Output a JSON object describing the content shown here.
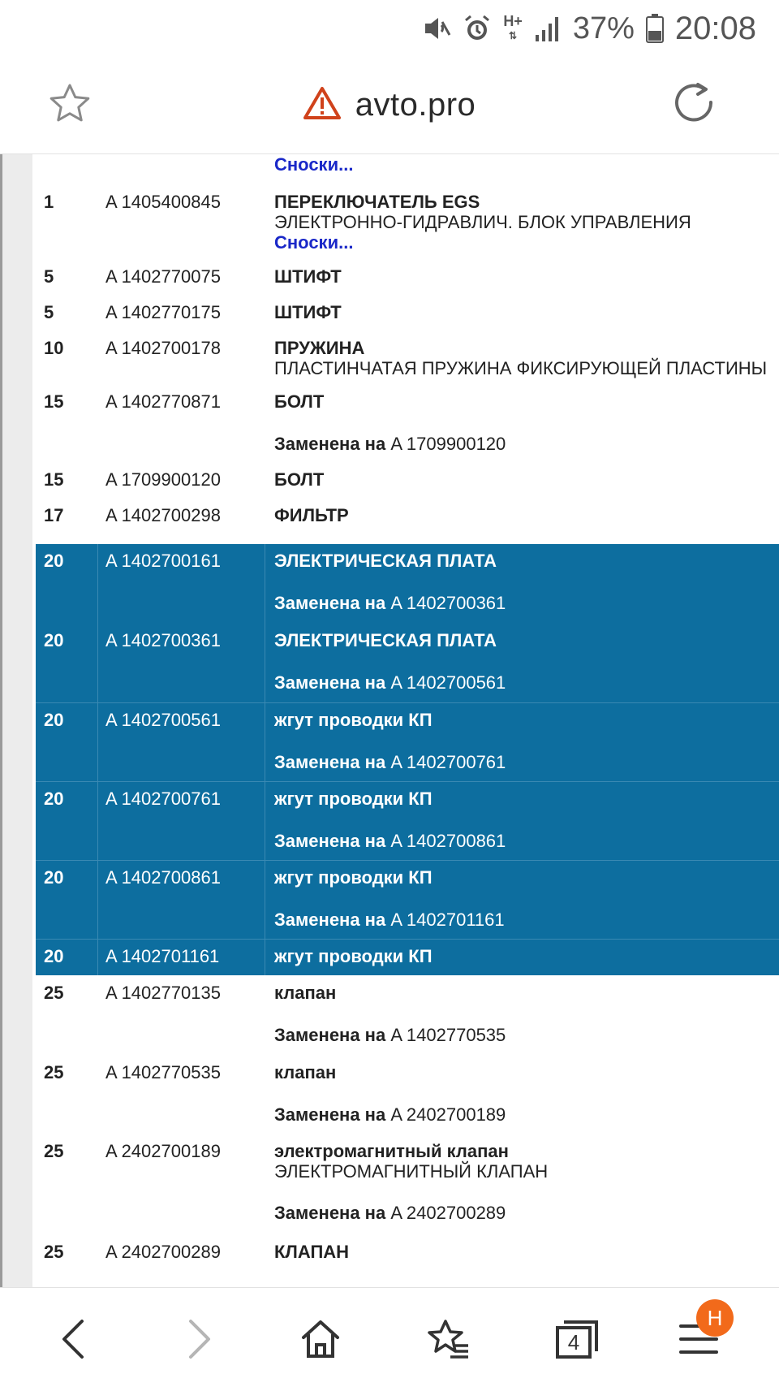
{
  "status_bar": {
    "battery": "37%",
    "time": "20:08",
    "network_label": "H+"
  },
  "address_bar": {
    "url": "avto.pro"
  },
  "rows": [
    {
      "num": "",
      "code": "",
      "name": "",
      "sub": "",
      "footnote": "Сноски...",
      "rep_label": "",
      "rep_code": ""
    },
    {
      "num": "1",
      "code": "A 1405400845",
      "name": "ПЕРЕКЛЮЧАТЕЛЬ EGS",
      "sub": "ЭЛЕКТРОННО-ГИДРАВЛИЧ. БЛОК УПРАВЛЕНИЯ",
      "footnote": "Сноски...",
      "rep_label": "",
      "rep_code": ""
    },
    {
      "num": "5",
      "code": "A 1402770075",
      "name": "ШТИФТ"
    },
    {
      "num": "5",
      "code": "A 1402770175",
      "name": "ШТИФТ"
    },
    {
      "num": "10",
      "code": "A 1402700178",
      "name": "ПРУЖИНА",
      "sub": "ПЛАСТИНЧАТАЯ ПРУЖИНА ФИКСИРУЮЩЕЙ ПЛАСТИНЫ"
    },
    {
      "num": "15",
      "code": "A 1402770871",
      "name": "БОЛТ",
      "rep_label": "Заменена на",
      "rep_code": "A 1709900120"
    },
    {
      "num": "15",
      "code": "A 1709900120",
      "name": "БОЛТ"
    },
    {
      "num": "17",
      "code": "A 1402700298",
      "name": "ФИЛЬТР"
    },
    {
      "num": "20",
      "code": "A 1402700161",
      "name": "ЭЛЕКТРИЧЕСКАЯ ПЛАТА",
      "rep_label": "Заменена на",
      "rep_code": "A 1402700361"
    },
    {
      "num": "20",
      "code": "A 1402700361",
      "name": "ЭЛЕКТРИЧЕСКАЯ ПЛАТА",
      "rep_label": "Заменена на",
      "rep_code": "A 1402700561"
    },
    {
      "num": "20",
      "code": "A 1402700561",
      "name": "жгут проводки КП",
      "rep_label": "Заменена на",
      "rep_code": "A 1402700761"
    },
    {
      "num": "20",
      "code": "A 1402700761",
      "name": "жгут проводки КП",
      "rep_label": "Заменена на",
      "rep_code": "A 1402700861"
    },
    {
      "num": "20",
      "code": "A 1402700861",
      "name": "жгут проводки КП",
      "rep_label": "Заменена на",
      "rep_code": "A 1402701161"
    },
    {
      "num": "20",
      "code": "A 1402701161",
      "name": "жгут проводки КП"
    },
    {
      "num": "25",
      "code": "A 1402770135",
      "name": "клапан",
      "rep_label": "Заменена на",
      "rep_code": "A 1402770535"
    },
    {
      "num": "25",
      "code": "A 1402770535",
      "name": "клапан",
      "rep_label": "Заменена на",
      "rep_code": "A 2402700189"
    },
    {
      "num": "25",
      "code": "A 2402700189",
      "name": "электромагнитный клапан",
      "sub": "ЭЛЕКТРОМАГНИТНЫЙ КЛАПАН",
      "rep_label": "Заменена на",
      "rep_code": "A 2402700289"
    },
    {
      "num": "25",
      "code": "A 2402700289",
      "name": "КЛАПАН"
    }
  ],
  "bottom_nav": {
    "tab_count": "4",
    "badge": "Н"
  },
  "colors": {
    "highlight": "#0d6e9f",
    "footnote_link": "#1a28c8",
    "badge": "#f26a1b",
    "warning": "#d0421b"
  },
  "icons": {
    "mute": "mute-icon",
    "alarm": "alarm-icon",
    "signal": "signal-icon",
    "battery": "battery-icon",
    "star": "star-icon",
    "warning": "warning-icon",
    "reload": "reload-icon",
    "back": "back-icon",
    "forward": "forward-icon",
    "home": "home-icon",
    "bookmarks": "bookmarks-icon",
    "tabs": "tabs-icon",
    "menu": "menu-icon"
  }
}
